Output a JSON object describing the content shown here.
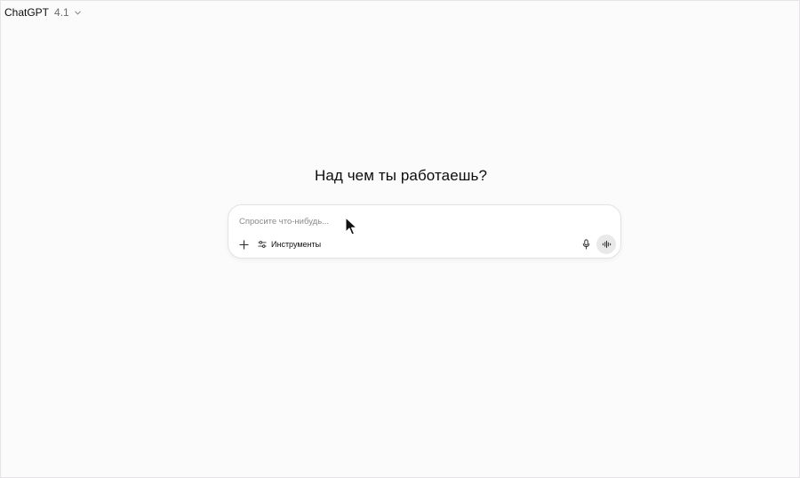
{
  "header": {
    "model_name": "ChatGPT",
    "model_version": "4.1",
    "chevron_icon": "chevron-down-icon"
  },
  "main": {
    "heading": "Над чем ты работаешь?"
  },
  "composer": {
    "placeholder": "Спросите что-нибудь...",
    "value": "",
    "add_icon": "plus-icon",
    "tools_icon": "sliders-icon",
    "tools_label": "Инструменты",
    "mic_icon": "microphone-icon",
    "voice_icon": "voice-waveform-icon"
  },
  "colors": {
    "background": "#fcfbfc",
    "composer_bg": "#ffffff",
    "voice_button_bg": "#e9e9e9",
    "text": "#0d0d0d",
    "muted_text": "#8a8a8a"
  }
}
